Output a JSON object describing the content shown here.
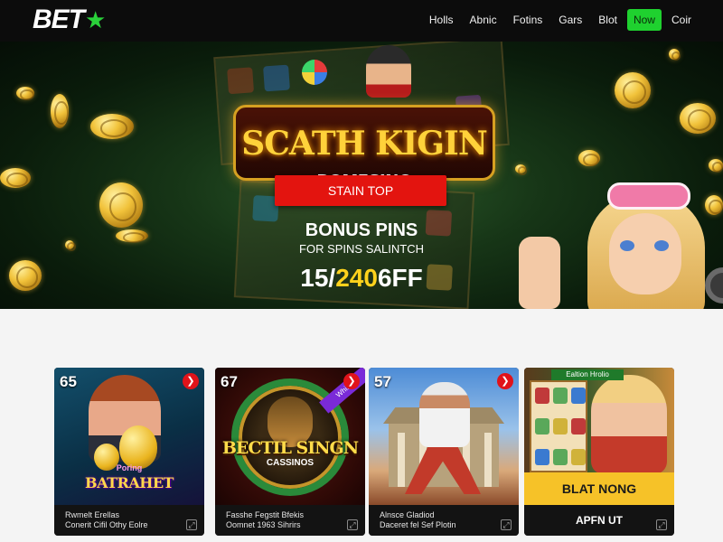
{
  "header": {
    "logo_text": "BET",
    "logo_icon": "star-icon",
    "nav": [
      {
        "label": "Holls"
      },
      {
        "label": "Abnic"
      },
      {
        "label": "Fotins"
      },
      {
        "label": "Gars"
      },
      {
        "label": "Blot"
      },
      {
        "label": "Now",
        "active": true
      },
      {
        "label": "Coir"
      }
    ]
  },
  "hero": {
    "game_title": "SCATH KIGIN",
    "game_subtitle": "BOMESINO",
    "cta_label": "STAIN TOP",
    "bonus_title": "BONUS PINS",
    "bonus_subtitle": "FOR SPINS SALINTCH",
    "bonus_amount_prefix": "15/",
    "bonus_amount_highlight": "240",
    "bonus_amount_suffix": "6FF"
  },
  "cards": [
    {
      "number": "65",
      "art_top_text": "Poring",
      "art_title": "BATRAHET",
      "footer_line1": "Rwmelt Erellas",
      "footer_line2": "Conerit Cifil Othy Eolre"
    },
    {
      "number": "67",
      "ribbon": "Whisnes",
      "art_title": "BECTIL SINGN",
      "art_subtitle": "CASSINOS",
      "footer_line1": "Fasshe Fegstit Bfekis",
      "footer_line2": "Oomnet 1963 Sihrirs"
    },
    {
      "number": "57",
      "footer_line1": "Alnsce Gladiod",
      "footer_line2": "Daceret fel Sef Plotin"
    },
    {
      "art_tag": "Ealtion Hrolio",
      "banner": "BLAT NONG",
      "footer_button": "APFN UT"
    }
  ],
  "colors": {
    "accent_green": "#1fd12f",
    "cta_red": "#e3140f",
    "highlight_yellow": "#ffd21c",
    "banner_yellow": "#f6c228"
  }
}
